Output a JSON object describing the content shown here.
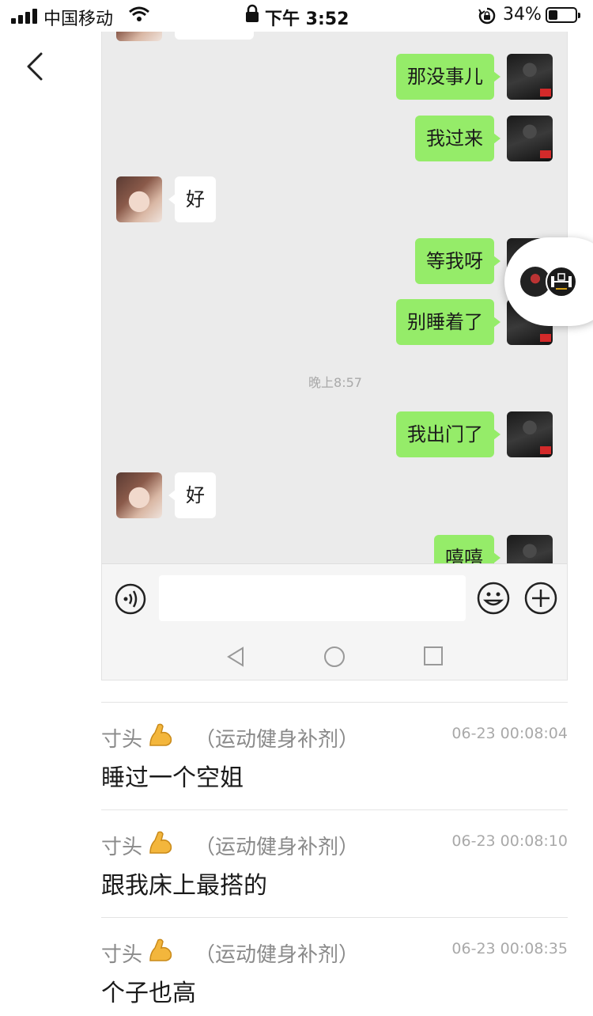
{
  "status_bar": {
    "carrier": "中国移动",
    "time": "下午 3:52",
    "battery_percent": "34%",
    "battery_level": 0.34
  },
  "chat": {
    "messages": [
      {
        "sender": "me",
        "text": "那没事儿"
      },
      {
        "sender": "me",
        "text": "我过来"
      },
      {
        "sender": "them",
        "text": "好"
      },
      {
        "sender": "me",
        "text": "等我呀"
      },
      {
        "sender": "me",
        "text": "别睡着了"
      },
      {
        "type": "timestamp",
        "text": "晚上8:57"
      },
      {
        "sender": "me",
        "text": "我出门了"
      },
      {
        "sender": "them",
        "text": "好"
      },
      {
        "sender": "me",
        "text": "嘻嘻"
      }
    ]
  },
  "comments": [
    {
      "user": "寸头",
      "emoji": "flexed-biceps-icon",
      "tag": "（运动健身补剂）",
      "time": "06-23 00:08:04",
      "text": "睡过一个空姐"
    },
    {
      "user": "寸头",
      "emoji": "flexed-biceps-icon",
      "tag": "（运动健身补剂）",
      "time": "06-23 00:08:10",
      "text": "跟我床上最搭的"
    },
    {
      "user": "寸头",
      "emoji": "flexed-biceps-icon",
      "tag": "（运动健身补剂）",
      "time": "06-23 00:08:35",
      "text": "个子也高"
    }
  ],
  "colors": {
    "bubble_me": "#95ec69",
    "bubble_them": "#ffffff",
    "chat_background": "#ebebeb",
    "meta_text": "#8a8a8a"
  }
}
